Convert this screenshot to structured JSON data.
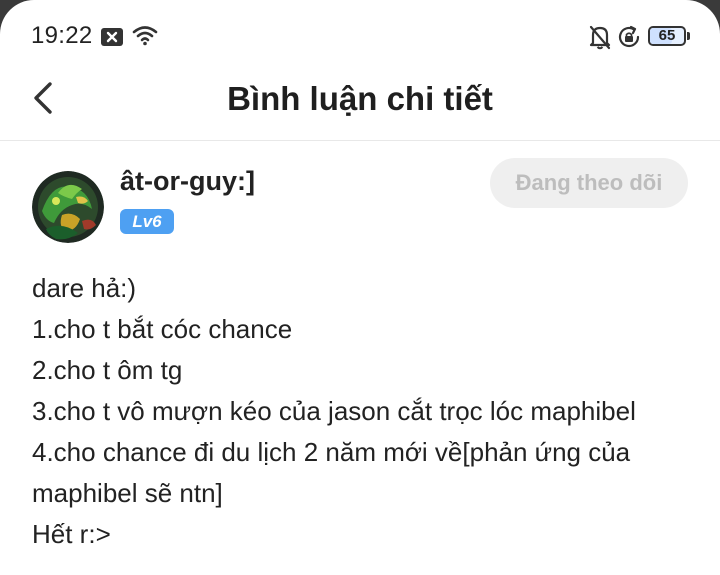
{
  "status_bar": {
    "time": "19:22",
    "battery": "65",
    "battery_fraction": 0.65,
    "icons": [
      "close-notification-icon",
      "wifi-icon",
      "bell-off-icon",
      "rotation-lock-icon",
      "battery-icon"
    ]
  },
  "header": {
    "title": "Bình luận chi tiết",
    "back_icon": "back-chevron-icon"
  },
  "comment": {
    "author": "ât-or-guy:]",
    "level": "Lv6",
    "follow_label": "Đang theo dõi",
    "lines": [
      "dare hả:)",
      "1.cho t bắt cóc chance",
      "2.cho t ôm tg",
      "3.cho t vô mượn kéo của jason cắt trọc lóc maphibel",
      "4.cho chance đi du lịch 2 năm mới về[phản ứng của",
      "maphibel sẽ ntn]",
      "Hết r:>"
    ]
  },
  "colors": {
    "accent": "#4ea0f2",
    "follow_bg": "#efefef",
    "follow_text": "#bdbdbd",
    "text": "#222222"
  }
}
